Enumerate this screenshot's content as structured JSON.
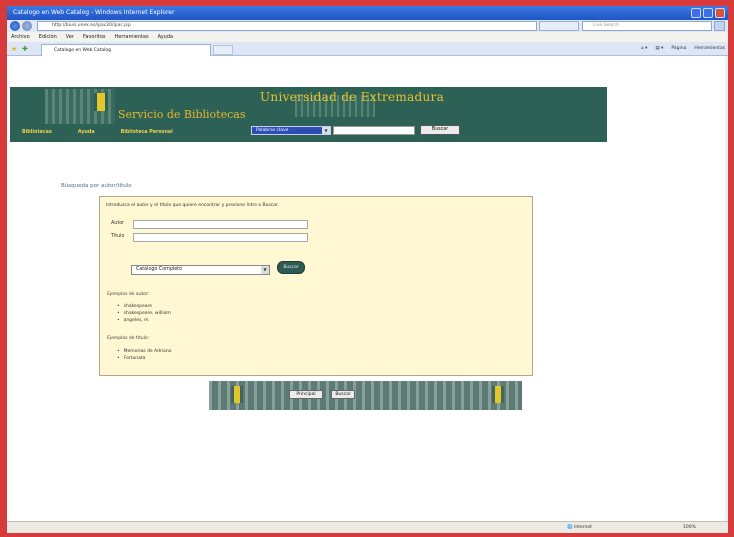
{
  "browser": {
    "window_title": "Catalogo en Web Catalog - Windows Internet Explorer",
    "address": "http://biusi.unex.es/ipac20/ipac.jsp",
    "search_placeholder": "Live Search",
    "menu": [
      "Archivo",
      "Edición",
      "Ver",
      "Favoritos",
      "Herramientas",
      "Ayuda"
    ],
    "tab_title": "Catalogo en Web Catalog",
    "command_items": [
      "Página",
      "Herramientas"
    ],
    "status_zone": "Internet",
    "status_zoom": "100%"
  },
  "banner": {
    "title": "Universidad de Extremadura",
    "subtitle": "Servicio de Bibliotecas",
    "links": [
      "Bibliotecas",
      "Ayuda",
      "Biblioteca Personal"
    ],
    "select_value": "Palabras clave",
    "button_label": "Buscar"
  },
  "search_form": {
    "section_title": "Búsqueda por autor/título",
    "intro": "Introduzca el autor y el título que quiere encontrar y presione Intro o Buscar.",
    "author_label": "Autor",
    "title_label": "Título",
    "catalog_select": "Catálogo Completo",
    "search_button": "Buscar",
    "author_examples_head": "Ejemplos de autor:",
    "author_examples": [
      "shakespeare",
      "shakespeare, william",
      "angeles, m"
    ],
    "title_examples_head": "Ejemplos de título:",
    "title_examples": [
      "Memorias de Adriano",
      "Fortunata"
    ]
  },
  "footer": {
    "buttons": [
      "Principal",
      "Buscar"
    ]
  }
}
